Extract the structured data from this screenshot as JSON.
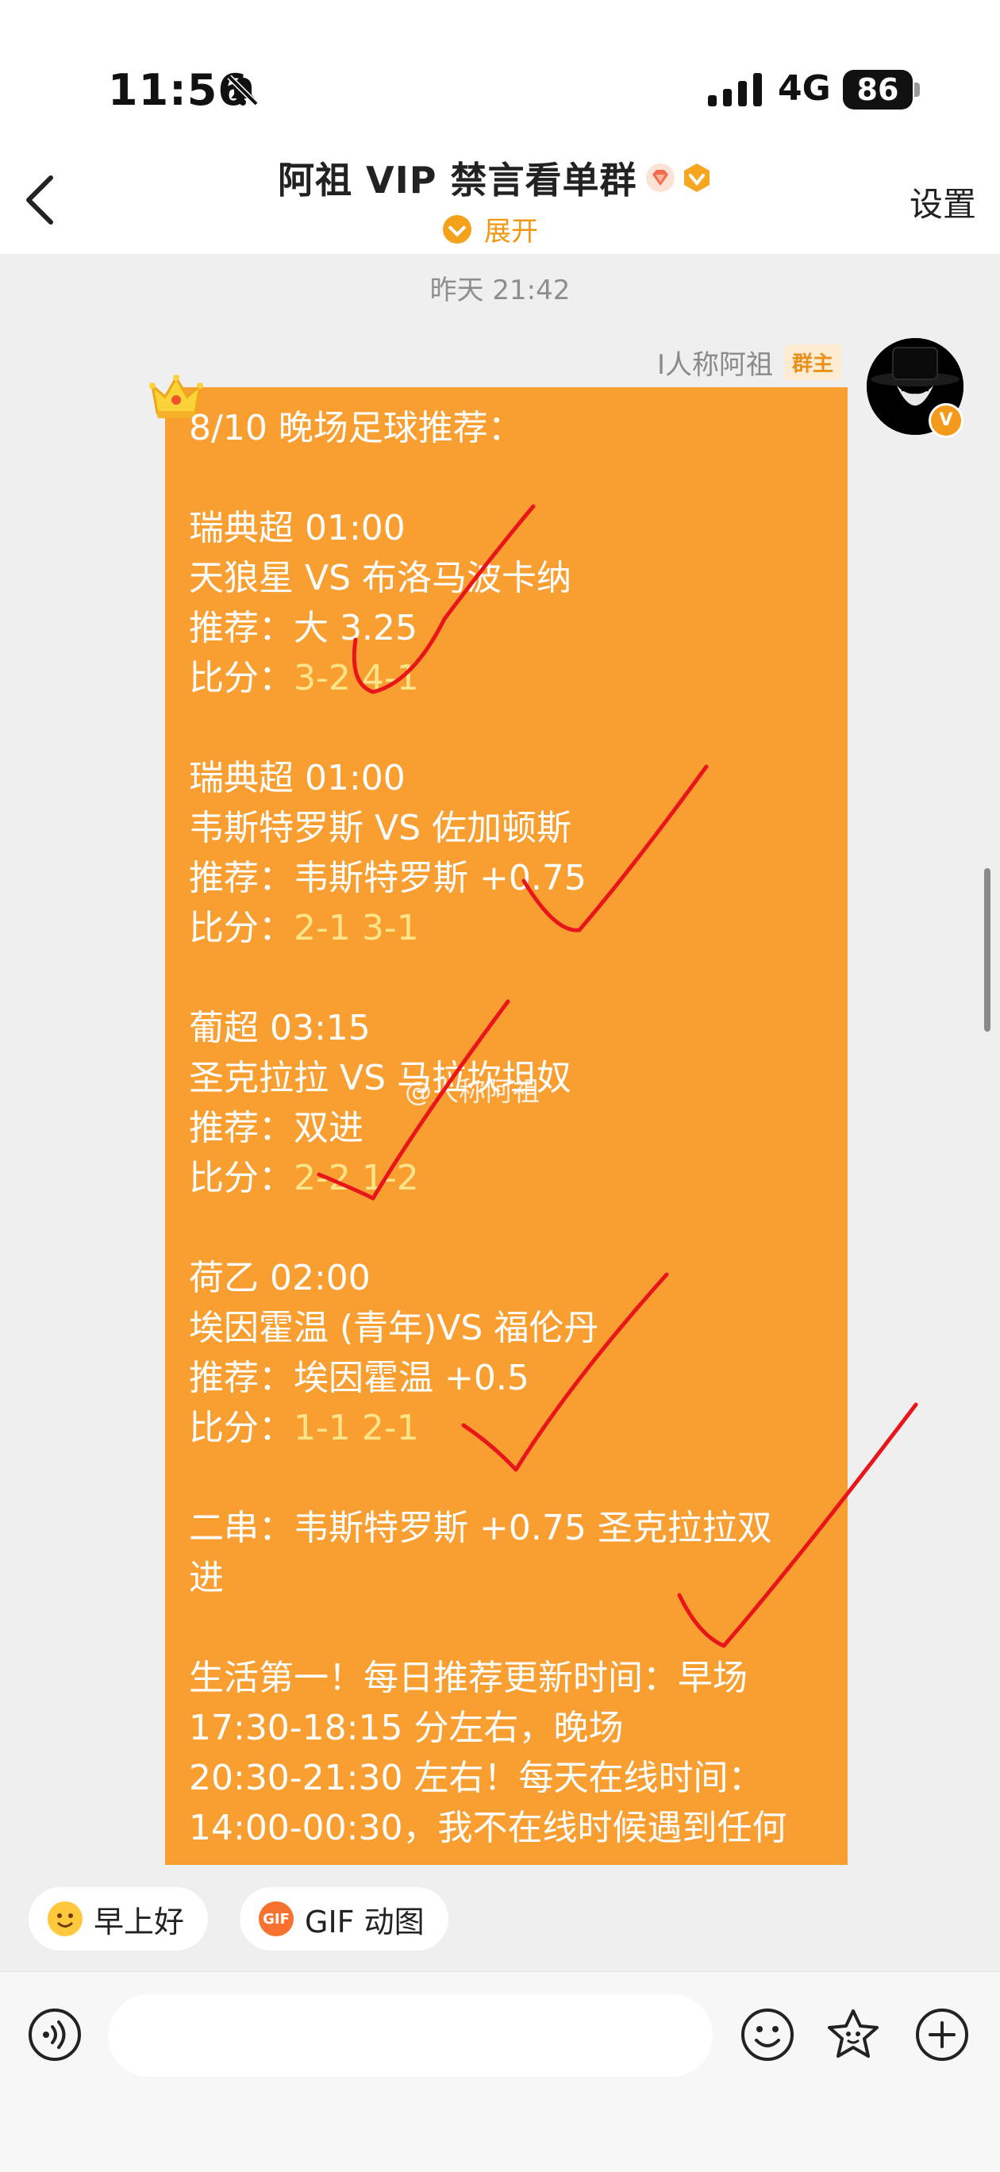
{
  "status_bar": {
    "time": "11:56",
    "network": "4G",
    "battery": "86"
  },
  "nav": {
    "title": "阿祖 VIP 禁言看单群",
    "expand_label": "展开",
    "settings_label": "设置"
  },
  "chat": {
    "timestamp": "昨天 21:42",
    "sender_name": "I人称阿祖",
    "sender_badge": "群主",
    "watermark": "@人称阿祖",
    "message_lines": [
      {
        "text": "8/10 晚场足球推荐："
      },
      {
        "text": ""
      },
      {
        "text": "瑞典超 01:00"
      },
      {
        "text": "天狼星 VS 布洛马波卡纳"
      },
      {
        "text": "推荐：大 3.25"
      },
      {
        "label": "比分：",
        "score": "3-2 4-1"
      },
      {
        "text": ""
      },
      {
        "text": "瑞典超 01:00"
      },
      {
        "text": "韦斯特罗斯 VS 佐加顿斯"
      },
      {
        "text": "推荐：韦斯特罗斯 +0.75"
      },
      {
        "label": "比分：",
        "score": "2-1 3-1"
      },
      {
        "text": ""
      },
      {
        "text": "葡超 03:15"
      },
      {
        "text": "圣克拉拉 VS 马拉坎坦奴"
      },
      {
        "text": "推荐：双进"
      },
      {
        "label": "比分：",
        "score": "2-2 1-2"
      },
      {
        "text": ""
      },
      {
        "text": "荷乙 02:00"
      },
      {
        "text": "埃因霍温 (青年)VS 福伦丹"
      },
      {
        "text": "推荐：埃因霍温 +0.5"
      },
      {
        "label": "比分：",
        "score": "1-1 2-1"
      },
      {
        "text": ""
      },
      {
        "text": "二串：韦斯特罗斯 +0.75 圣克拉拉双"
      },
      {
        "text": "进"
      },
      {
        "text": ""
      },
      {
        "text": "生活第一！每日推荐更新时间：早场"
      },
      {
        "text": "17:30-18:15 分左右，晚场"
      },
      {
        "text": "20:30-21:30 左右！每天在线时间："
      },
      {
        "text": "14:00-00:30，我不在线时候遇到任何"
      }
    ]
  },
  "quick_replies": [
    {
      "label": "早上好",
      "icon": "smile-emoji-icon"
    },
    {
      "label": "GIF 动图",
      "icon": "gif-icon"
    }
  ],
  "input": {
    "placeholder": ""
  },
  "colors": {
    "accent": "#F99F32",
    "score": "#FFE58A",
    "check": "#E8161A"
  }
}
